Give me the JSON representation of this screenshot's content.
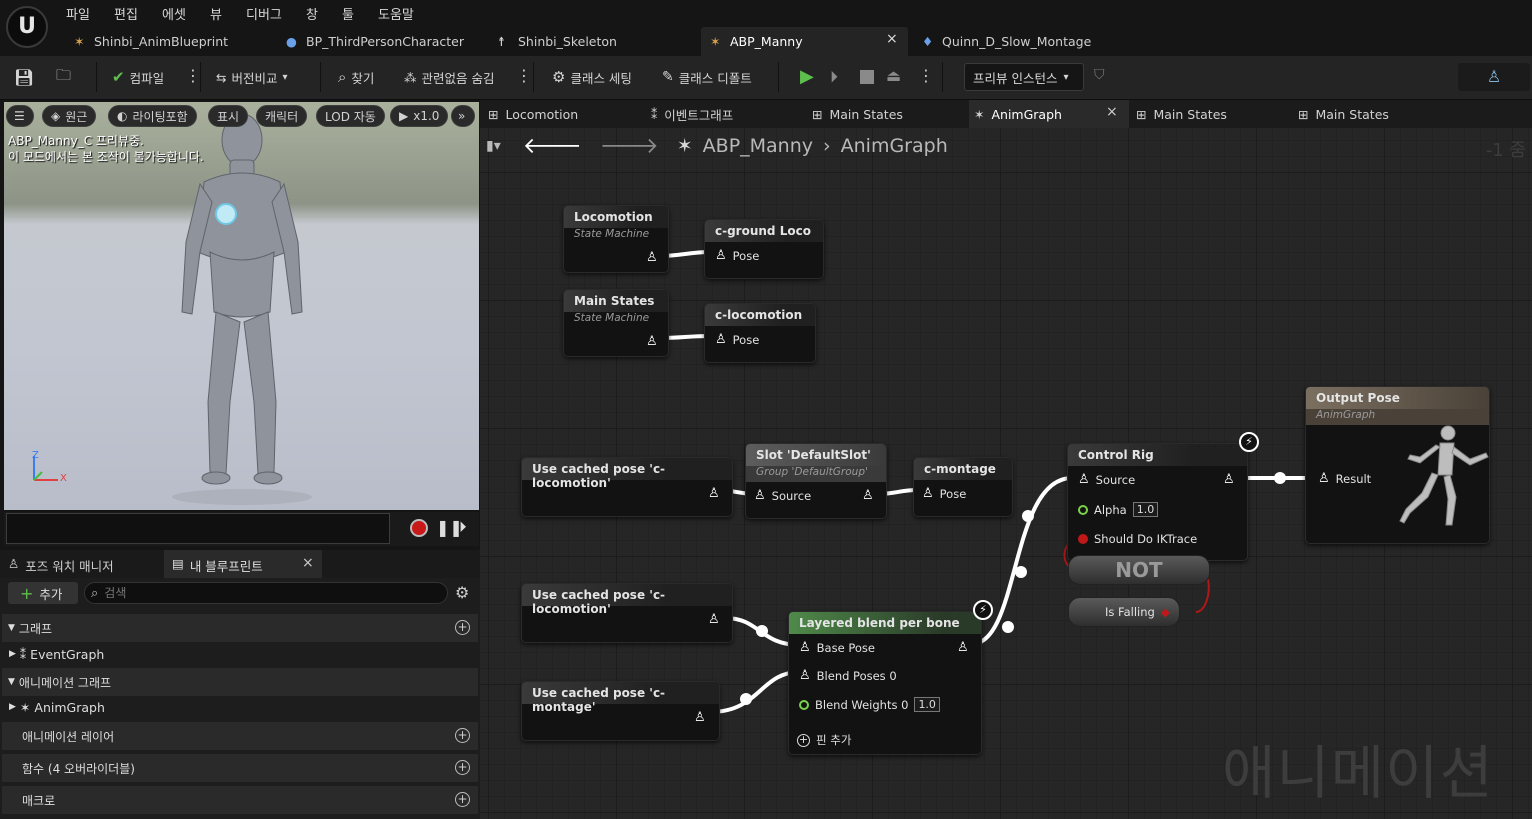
{
  "menu": [
    "파일",
    "편집",
    "에셋",
    "뷰",
    "디버그",
    "창",
    "툴",
    "도움말"
  ],
  "tabs": [
    {
      "label": "Shinbi_AnimBlueprint",
      "icon": "anim-blueprint-icon"
    },
    {
      "label": "BP_ThirdPersonCharacter",
      "icon": "character-blueprint-icon"
    },
    {
      "label": "Shinbi_Skeleton",
      "icon": "skeleton-icon"
    },
    {
      "label": "ABP_Manny",
      "icon": "anim-blueprint-icon",
      "active": true
    },
    {
      "label": "Quinn_D_Slow_Montage",
      "icon": "montage-icon"
    }
  ],
  "toolbar": {
    "compile": "컴파일",
    "diff": "버전비교",
    "find": "찾기",
    "hide_unrelated": "관련없음 숨김",
    "class_settings": "클래스 세팅",
    "class_defaults": "클래스 디폴트",
    "preview_instance": "프리뷰 인스턴스"
  },
  "viewport": {
    "perspective": "원근",
    "lighting": "라이팅포함",
    "show": "표시",
    "character": "캐릭터",
    "lod": "LOD 자동",
    "speed": "x1.0",
    "info_line1": "ABP_Manny_C 프리뷰중.",
    "info_line2": "이 모드에서는 본 조작이 불가능합니다.",
    "axis_z": "Z",
    "axis_x": "X"
  },
  "bottom_tabs": {
    "pose_watch": "포즈 워치 매니저",
    "my_blueprint": "내 블루프린트"
  },
  "my_blueprint": {
    "add": "추가",
    "search_placeholder": "검색",
    "graphs": "그래프",
    "event_graph": "EventGraph",
    "anim_graphs": "애니메이션 그래프",
    "anim_graph": "AnimGraph",
    "anim_layers": "애니메이션 레이어",
    "functions": "함수 (4 오버라이더블)",
    "macros": "매크로"
  },
  "graph_tabs": [
    {
      "label": "Locomotion"
    },
    {
      "label": "이벤트그래프"
    },
    {
      "label": "Main States"
    },
    {
      "label": "AnimGraph",
      "active": true
    },
    {
      "label": "Main States"
    },
    {
      "label": "Main States"
    }
  ],
  "breadcrumb": {
    "root": "ABP_Manny",
    "current": "AnimGraph",
    "zoom": "-1 줌"
  },
  "watermark": "애니메이션",
  "nodes": {
    "sm_locomotion": {
      "title": "Locomotion",
      "subtitle": "State Machine"
    },
    "cache_ground": {
      "title": "c-ground Loco",
      "pin": "Pose"
    },
    "sm_main": {
      "title": "Main States",
      "subtitle": "State Machine"
    },
    "cache_loco": {
      "title": "c-locomotion",
      "pin": "Pose"
    },
    "use_cached_1": {
      "title": "Use cached pose 'c-locomotion'"
    },
    "slot": {
      "title": "Slot 'DefaultSlot'",
      "subtitle": "Group 'DefaultGroup'",
      "pin": "Source"
    },
    "cache_montage": {
      "title": "c-montage",
      "pin": "Pose"
    },
    "use_cached_2": {
      "title": "Use cached pose 'c-locomotion'"
    },
    "use_cached_3": {
      "title": "Use cached pose 'c-montage'"
    },
    "layered": {
      "title": "Layered blend per bone",
      "base": "Base Pose",
      "blend_poses": "Blend Poses 0",
      "blend_weights": "Blend Weights 0",
      "weight_value": "1.0",
      "add_pin": "핀 추가"
    },
    "control_rig": {
      "title": "Control Rig",
      "source": "Source",
      "alpha": "Alpha",
      "alpha_value": "1.0",
      "should_do": "Should Do IKTrace"
    },
    "not_node": {
      "title": "NOT"
    },
    "is_falling": {
      "title": "Is Falling"
    },
    "output": {
      "title": "Output Pose",
      "subtitle": "AnimGraph",
      "pin": "Result"
    }
  }
}
